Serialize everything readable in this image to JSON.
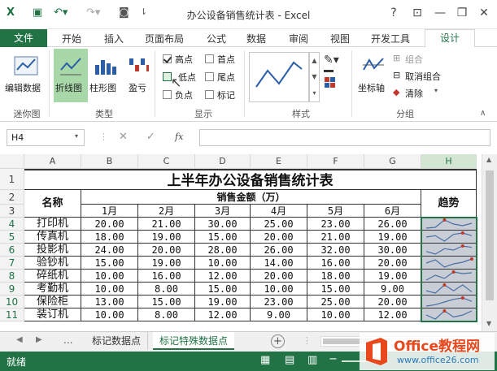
{
  "window": {
    "title": "办公设备销售统计表 - Excel",
    "help": "?"
  },
  "tabs": [
    "开始",
    "插入",
    "页面布局",
    "公式",
    "数据",
    "审阅",
    "视图",
    "开发工具"
  ],
  "tab_file": "文件",
  "tab_active": "设计",
  "ribbon": {
    "sparkline_group": {
      "edit_data": "编辑数据",
      "label": "迷你图"
    },
    "type_group": {
      "line": "折线图",
      "column": "柱形图",
      "winloss": "盈亏",
      "label": "类型"
    },
    "show_group": {
      "label": "显示",
      "items": [
        {
          "label": "高点",
          "checked": true
        },
        {
          "label": "首点",
          "checked": false
        },
        {
          "label": "低点",
          "checked": false
        },
        {
          "label": "尾点",
          "checked": false
        },
        {
          "label": "负点",
          "checked": false
        },
        {
          "label": "标记",
          "checked": false
        }
      ]
    },
    "style_group": {
      "label": "样式"
    },
    "group_group": {
      "axis": "坐标轴",
      "group": "组合",
      "ungroup": "取消组合",
      "clear": "清除",
      "label": "分组"
    }
  },
  "formula_bar": {
    "name_box": "H4",
    "fx": "fx",
    "value": ""
  },
  "columns": [
    "A",
    "B",
    "C",
    "D",
    "E",
    "F",
    "G",
    "H"
  ],
  "rows": [
    "1",
    "2",
    "3",
    "4",
    "5",
    "6",
    "7",
    "8",
    "9",
    "10",
    "11"
  ],
  "sheet": {
    "title": "上半年办公设备销售统计表",
    "name_header": "名称",
    "amount_header": "销售金额（万）",
    "trend_header": "趋势",
    "months": [
      "1月",
      "2月",
      "3月",
      "4月",
      "5月",
      "6月"
    ],
    "data": [
      {
        "name": "打印机",
        "values": [
          "20.00",
          "21.00",
          "30.00",
          "25.00",
          "23.00",
          "26.00"
        ]
      },
      {
        "name": "传真机",
        "values": [
          "18.00",
          "19.00",
          "15.00",
          "20.00",
          "21.00",
          "19.00"
        ]
      },
      {
        "name": "投影机",
        "values": [
          "24.00",
          "20.00",
          "28.00",
          "26.00",
          "32.00",
          "30.00"
        ]
      },
      {
        "name": "验钞机",
        "values": [
          "15.00",
          "19.00",
          "10.00",
          "14.00",
          "16.00",
          "20.00"
        ]
      },
      {
        "name": "碎纸机",
        "values": [
          "10.00",
          "16.00",
          "12.00",
          "20.00",
          "18.00",
          "19.00"
        ]
      },
      {
        "name": "考勤机",
        "values": [
          "10.00",
          "8.00",
          "15.00",
          "10.00",
          "15.00",
          "9.00"
        ]
      },
      {
        "name": "保险柜",
        "values": [
          "13.00",
          "15.00",
          "19.00",
          "23.00",
          "25.00",
          "20.00"
        ]
      },
      {
        "name": "装订机",
        "values": [
          "10.00",
          "8.00",
          "12.00",
          "9.00",
          "10.00",
          "12.00"
        ]
      }
    ]
  },
  "sheet_tabs": {
    "nav_more": "...",
    "tab1": "标记数据点",
    "tab2": "标记特殊数据点",
    "add": "+"
  },
  "status": {
    "ready": "就绪"
  },
  "watermark": {
    "line1": "Office教程网",
    "line2": "www.office26.com"
  },
  "colors": {
    "accent": "#217346",
    "sparkline": "#4a6fa5",
    "high_marker": "#c0392b"
  }
}
